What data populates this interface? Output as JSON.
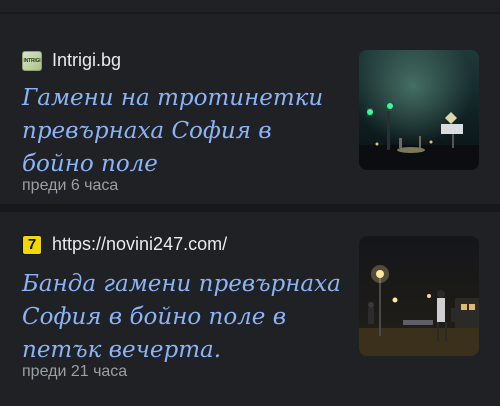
{
  "articles": [
    {
      "source": "Intrigi.bg",
      "favicon": "intrigi-favicon",
      "favicon_text": "INTRIGI",
      "headline": "Гамени на тротинетки превърнаха София в бойно поле",
      "time": "преди 6 часа",
      "thumbnail": "night-street-traffic-lights-image"
    },
    {
      "source": "https://novini247.com/",
      "favicon": "novini247-favicon",
      "favicon_text": "7",
      "headline": "Банда гамени превърнаха София в бойно поле в петък вечерта.",
      "time": "преди 21 часа",
      "thumbnail": "night-street-people-scooters-image"
    }
  ],
  "colors": {
    "background": "#202124",
    "headline": "#8ab4f8",
    "source": "#e8eaed",
    "timestamp": "#9aa0a6"
  }
}
